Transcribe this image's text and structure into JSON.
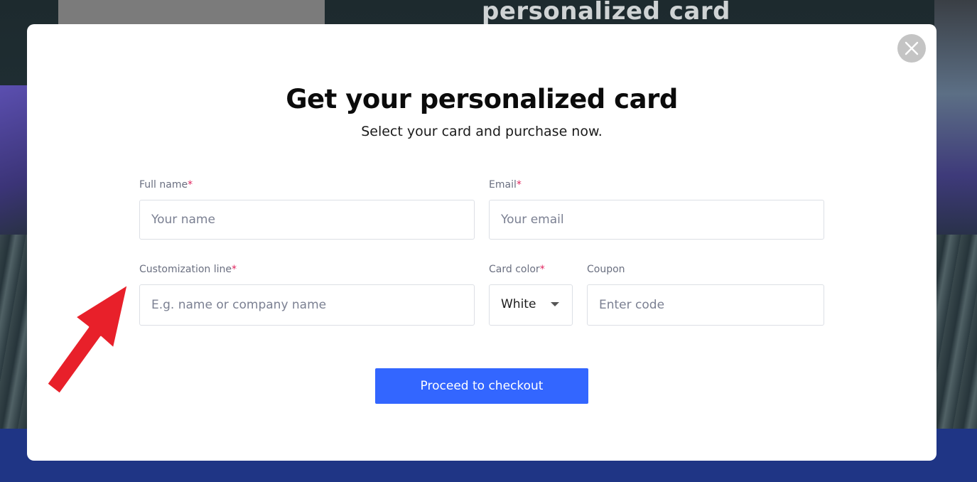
{
  "background": {
    "heading": "personalized card"
  },
  "modal": {
    "title": "Get your personalized card",
    "subtitle": "Select your card and purchase now.",
    "required_mark": "*",
    "fields": {
      "full_name": {
        "label": "Full name",
        "placeholder": "Your name"
      },
      "email": {
        "label": "Email",
        "placeholder": "Your email"
      },
      "customization": {
        "label": "Customization line",
        "placeholder": "E.g. name or company name"
      },
      "card_color": {
        "label": "Card color",
        "value": "White"
      },
      "coupon": {
        "label": "Coupon",
        "placeholder": "Enter code"
      }
    },
    "checkout_label": "Proceed to checkout"
  },
  "colors": {
    "accent": "#3366ff",
    "required": "#e0245e",
    "annotation_arrow": "#e8202a",
    "footer_band": "#1f3585"
  },
  "icons": {
    "close": "close-icon",
    "caret": "chevron-down-icon",
    "annotation": "red-arrow-annotation"
  }
}
